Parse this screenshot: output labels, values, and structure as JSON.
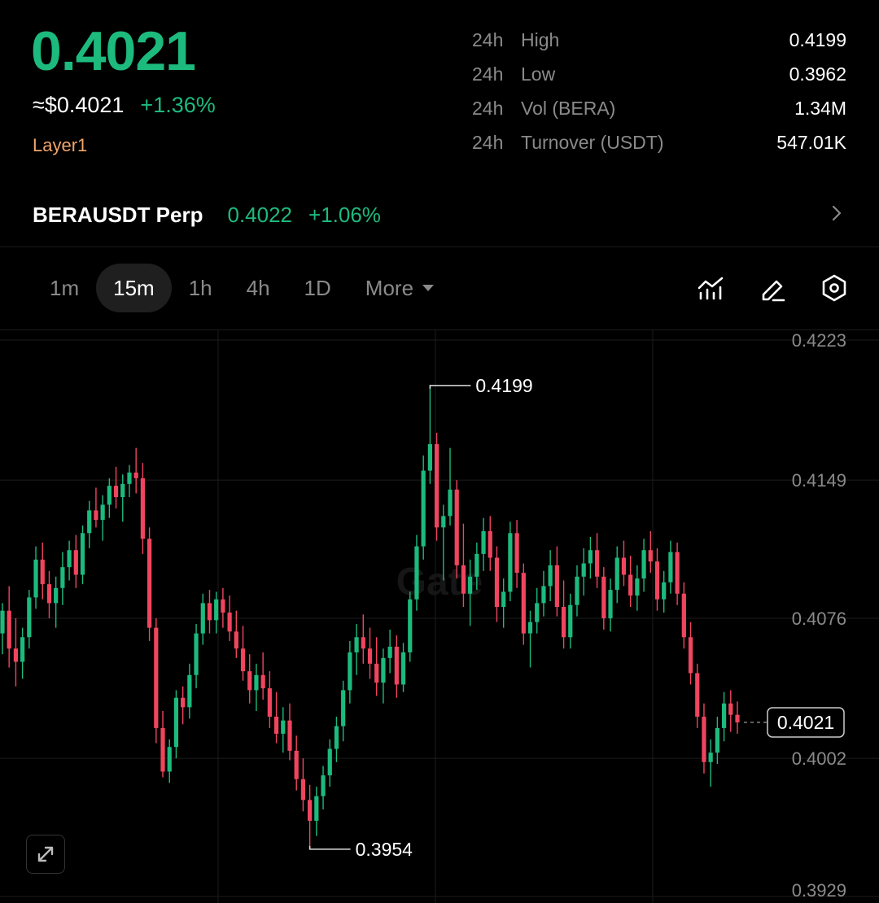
{
  "header": {
    "last_price": "0.4021",
    "usd_price": "≈$0.4021",
    "change_pct": "+1.36%",
    "tag": "Layer1"
  },
  "stats": [
    {
      "period": "24h",
      "label": "High",
      "value": "0.4199"
    },
    {
      "period": "24h",
      "label": "Low",
      "value": "0.3962"
    },
    {
      "period": "24h",
      "label": "Vol (BERA)",
      "value": "1.34M"
    },
    {
      "period": "24h",
      "label": "Turnover (USDT)",
      "value": "547.01K"
    }
  ],
  "perp": {
    "name": "BERAUSDT Perp",
    "price": "0.4022",
    "change": "+1.06%"
  },
  "tabs": [
    {
      "label": "1m",
      "active": false
    },
    {
      "label": "15m",
      "active": true
    },
    {
      "label": "1h",
      "active": false
    },
    {
      "label": "4h",
      "active": false
    },
    {
      "label": "1D",
      "active": false
    },
    {
      "label": "More",
      "active": false
    }
  ],
  "icons": {
    "indicators": "indicators-icon",
    "draw": "pencil-icon",
    "settings": "settings-hex-icon",
    "expand": "expand-icon",
    "chevron": "chevron-right-icon",
    "dropdown": "caret-down-icon"
  },
  "colors": {
    "up": "#1dba7e",
    "down": "#f0455f",
    "accent_tag": "#f0a46b"
  },
  "chart_data": {
    "type": "candlestick",
    "y_ticks": [
      "0.4223",
      "0.4149",
      "0.4076",
      "0.4002",
      "0.3929"
    ],
    "ylim": [
      0.3929,
      0.4223
    ],
    "high_marker": "0.4199",
    "low_marker": "0.3954",
    "current_price_label": "0.4021",
    "candles": [
      [
        0.4068,
        0.4084,
        0.4057,
        0.408
      ],
      [
        0.408,
        0.4093,
        0.405,
        0.406
      ],
      [
        0.406,
        0.4076,
        0.404,
        0.4053
      ],
      [
        0.4053,
        0.4071,
        0.4044,
        0.4066
      ],
      [
        0.4066,
        0.4091,
        0.406,
        0.4087
      ],
      [
        0.4087,
        0.4114,
        0.4081,
        0.4107
      ],
      [
        0.4107,
        0.4116,
        0.4086,
        0.4094
      ],
      [
        0.4094,
        0.4101,
        0.4076,
        0.4084
      ],
      [
        0.4084,
        0.4098,
        0.4071,
        0.4092
      ],
      [
        0.4092,
        0.4111,
        0.4083,
        0.4103
      ],
      [
        0.4103,
        0.4117,
        0.4096,
        0.4112
      ],
      [
        0.4112,
        0.412,
        0.4092,
        0.4099
      ],
      [
        0.4099,
        0.4125,
        0.4094,
        0.4121
      ],
      [
        0.4121,
        0.4138,
        0.4113,
        0.4133
      ],
      [
        0.4133,
        0.4145,
        0.4124,
        0.4128
      ],
      [
        0.4128,
        0.4141,
        0.4117,
        0.4136
      ],
      [
        0.4136,
        0.415,
        0.4129,
        0.4146
      ],
      [
        0.4146,
        0.4156,
        0.4134,
        0.414
      ],
      [
        0.414,
        0.4152,
        0.4127,
        0.4147
      ],
      [
        0.4147,
        0.4157,
        0.414,
        0.4153
      ],
      [
        0.4153,
        0.4166,
        0.4142,
        0.415
      ],
      [
        0.415,
        0.4158,
        0.411,
        0.4118
      ],
      [
        0.4118,
        0.4124,
        0.4064,
        0.4071
      ],
      [
        0.4071,
        0.4076,
        0.401,
        0.4018
      ],
      [
        0.4018,
        0.4027,
        0.3992,
        0.3995
      ],
      [
        0.3995,
        0.4012,
        0.3989,
        0.4008
      ],
      [
        0.4008,
        0.4038,
        0.4002,
        0.4034
      ],
      [
        0.4034,
        0.404,
        0.402,
        0.4029
      ],
      [
        0.4029,
        0.4052,
        0.4023,
        0.4046
      ],
      [
        0.4046,
        0.4073,
        0.4039,
        0.4068
      ],
      [
        0.4068,
        0.4089,
        0.4062,
        0.4084
      ],
      [
        0.4084,
        0.4091,
        0.4068,
        0.4075
      ],
      [
        0.4075,
        0.409,
        0.4068,
        0.4086
      ],
      [
        0.4086,
        0.4092,
        0.4071,
        0.4079
      ],
      [
        0.4079,
        0.4088,
        0.4064,
        0.4069
      ],
      [
        0.4069,
        0.408,
        0.4055,
        0.406
      ],
      [
        0.406,
        0.4072,
        0.4043,
        0.4048
      ],
      [
        0.4048,
        0.4057,
        0.4031,
        0.4038
      ],
      [
        0.4038,
        0.4052,
        0.4027,
        0.4046
      ],
      [
        0.4046,
        0.4058,
        0.4033,
        0.4039
      ],
      [
        0.4039,
        0.4048,
        0.4018,
        0.4024
      ],
      [
        0.4024,
        0.4037,
        0.401,
        0.4015
      ],
      [
        0.4015,
        0.4029,
        0.4005,
        0.4022
      ],
      [
        0.4022,
        0.4031,
        0.4001,
        0.4006
      ],
      [
        0.4006,
        0.4014,
        0.3985,
        0.3991
      ],
      [
        0.3991,
        0.4002,
        0.3974,
        0.398
      ],
      [
        0.398,
        0.3988,
        0.3954,
        0.3969
      ],
      [
        0.3969,
        0.3987,
        0.3961,
        0.3982
      ],
      [
        0.3982,
        0.3998,
        0.3975,
        0.3993
      ],
      [
        0.3993,
        0.4012,
        0.3987,
        0.4007
      ],
      [
        0.4007,
        0.4024,
        0.4,
        0.4019
      ],
      [
        0.4019,
        0.4043,
        0.4011,
        0.4038
      ],
      [
        0.4038,
        0.4064,
        0.4031,
        0.4058
      ],
      [
        0.4058,
        0.4073,
        0.4046,
        0.4066
      ],
      [
        0.4066,
        0.4078,
        0.4052,
        0.406
      ],
      [
        0.406,
        0.4071,
        0.4044,
        0.4052
      ],
      [
        0.4052,
        0.4066,
        0.4035,
        0.4042
      ],
      [
        0.4042,
        0.406,
        0.4031,
        0.4055
      ],
      [
        0.4055,
        0.407,
        0.4047,
        0.4061
      ],
      [
        0.4061,
        0.4067,
        0.4034,
        0.4041
      ],
      [
        0.4041,
        0.4063,
        0.4037,
        0.4058
      ],
      [
        0.4058,
        0.409,
        0.4053,
        0.4086
      ],
      [
        0.4086,
        0.412,
        0.408,
        0.4114
      ],
      [
        0.4114,
        0.4162,
        0.4107,
        0.4154
      ],
      [
        0.4154,
        0.4199,
        0.4147,
        0.4168
      ],
      [
        0.4168,
        0.4174,
        0.4117,
        0.4124
      ],
      [
        0.4124,
        0.4136,
        0.4096,
        0.413
      ],
      [
        0.413,
        0.4166,
        0.4125,
        0.4144
      ],
      [
        0.4144,
        0.4149,
        0.4097,
        0.4104
      ],
      [
        0.4104,
        0.4126,
        0.4082,
        0.4089
      ],
      [
        0.4089,
        0.4107,
        0.4072,
        0.4098
      ],
      [
        0.4098,
        0.4116,
        0.4091,
        0.411
      ],
      [
        0.411,
        0.4129,
        0.4101,
        0.4122
      ],
      [
        0.4122,
        0.413,
        0.4101,
        0.4108
      ],
      [
        0.4108,
        0.4114,
        0.4074,
        0.4082
      ],
      [
        0.4082,
        0.4097,
        0.4071,
        0.409
      ],
      [
        0.409,
        0.4127,
        0.4085,
        0.4121
      ],
      [
        0.4121,
        0.4128,
        0.4092,
        0.41
      ],
      [
        0.41,
        0.4105,
        0.4062,
        0.4068
      ],
      [
        0.4068,
        0.408,
        0.405,
        0.4074
      ],
      [
        0.4074,
        0.4092,
        0.4068,
        0.4084
      ],
      [
        0.4084,
        0.4101,
        0.4077,
        0.4093
      ],
      [
        0.4093,
        0.4112,
        0.4085,
        0.4104
      ],
      [
        0.4104,
        0.4114,
        0.4077,
        0.4082
      ],
      [
        0.4082,
        0.4096,
        0.406,
        0.4066
      ],
      [
        0.4066,
        0.4089,
        0.406,
        0.4083
      ],
      [
        0.4083,
        0.4104,
        0.4077,
        0.4098
      ],
      [
        0.4098,
        0.4113,
        0.4088,
        0.4105
      ],
      [
        0.4105,
        0.4119,
        0.4097,
        0.4112
      ],
      [
        0.4112,
        0.4121,
        0.4092,
        0.4098
      ],
      [
        0.4098,
        0.4103,
        0.407,
        0.4076
      ],
      [
        0.4076,
        0.4097,
        0.4069,
        0.4091
      ],
      [
        0.4091,
        0.4114,
        0.4084,
        0.4108
      ],
      [
        0.4108,
        0.4117,
        0.4093,
        0.4099
      ],
      [
        0.4099,
        0.4109,
        0.4082,
        0.4088
      ],
      [
        0.4088,
        0.4104,
        0.408,
        0.4097
      ],
      [
        0.4097,
        0.4118,
        0.409,
        0.4112
      ],
      [
        0.4112,
        0.4122,
        0.41,
        0.4106
      ],
      [
        0.4106,
        0.4113,
        0.408,
        0.4086
      ],
      [
        0.4086,
        0.4101,
        0.4079,
        0.4095
      ],
      [
        0.4095,
        0.4117,
        0.4089,
        0.4111
      ],
      [
        0.4111,
        0.4116,
        0.4083,
        0.4089
      ],
      [
        0.4089,
        0.4095,
        0.406,
        0.4066
      ],
      [
        0.4066,
        0.4074,
        0.4041,
        0.4047
      ],
      [
        0.4047,
        0.4052,
        0.4018,
        0.4024
      ],
      [
        0.4024,
        0.4031,
        0.3994,
        0.4
      ],
      [
        0.4,
        0.4012,
        0.3987,
        0.4005
      ],
      [
        0.4005,
        0.4024,
        0.3999,
        0.4018
      ],
      [
        0.4018,
        0.4037,
        0.4011,
        0.4031
      ],
      [
        0.4031,
        0.4038,
        0.4016,
        0.4025
      ],
      [
        0.4025,
        0.4032,
        0.4015,
        0.4021
      ]
    ]
  }
}
